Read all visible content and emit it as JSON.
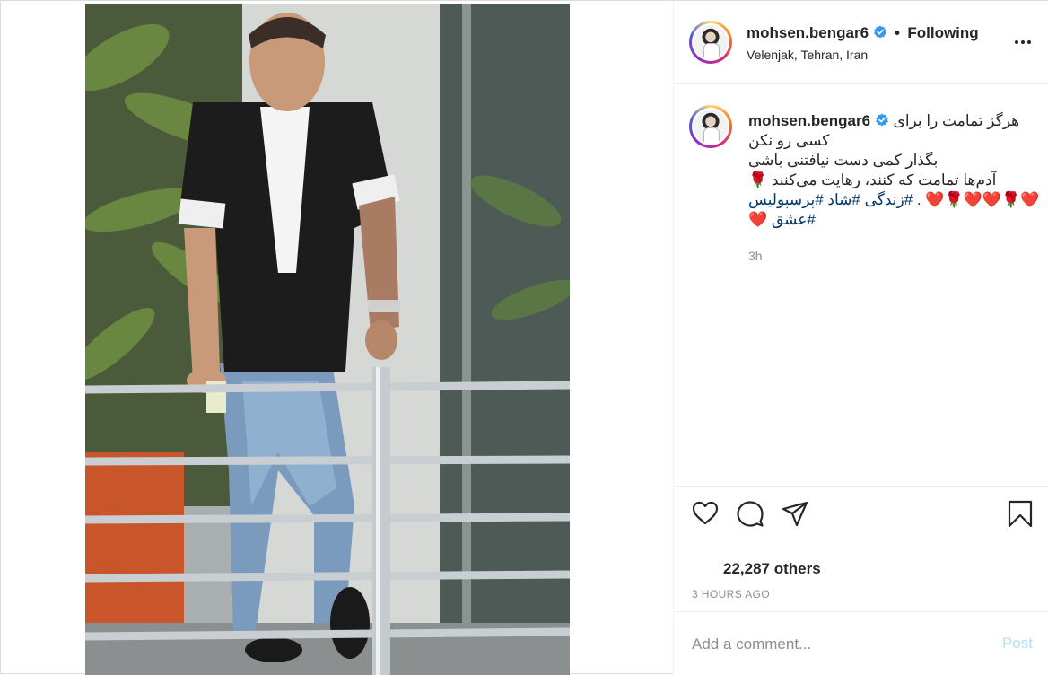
{
  "post": {
    "username": "mohsen.bengar6",
    "follow_status": "Following",
    "location": "Velenjak, Tehran, Iran",
    "caption": {
      "lines": [
        "هرگز تمامت را برای",
        "کسی رو نکن",
        "بگذار کمی دست نیافتنی باشی",
        "آدم‌ها تمامت که کنند، رهایت می‌کنند 🌹",
        "❤️🌹❤️❤️🌹❤️ .",
        "#زندگی #شاد #پرسپولیس",
        "#عشق ❤️"
      ]
    },
    "caption_age": "3h",
    "likes_text": "22,287 others",
    "post_time": "3 HOURS AGO",
    "comment_placeholder": "Add a comment...",
    "post_label": "Post"
  },
  "icons": {
    "verified": "verified-badge-icon",
    "more": "more-options-icon",
    "like": "heart-icon",
    "comment": "comment-icon",
    "share": "share-icon",
    "save": "bookmark-icon"
  },
  "colors": {
    "verified_blue": "#3897f0",
    "hashtag": "#00376b",
    "muted": "#8e8e8e",
    "post_button_disabled": "#b2dffc",
    "divider": "#efefef"
  }
}
